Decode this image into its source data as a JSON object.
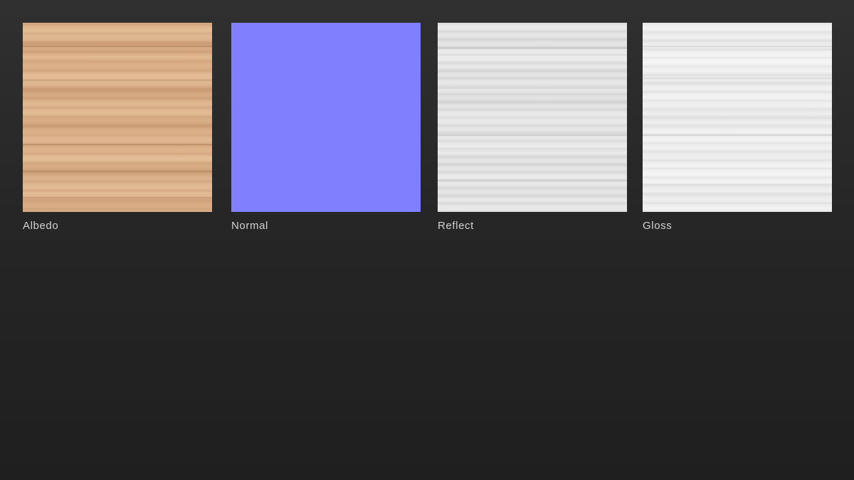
{
  "textures": [
    {
      "label": "Albedo",
      "map_type": "albedo",
      "base_color": "#dbb18a"
    },
    {
      "label": "Normal",
      "map_type": "normal",
      "base_color": "#8080ff"
    },
    {
      "label": "Reflect",
      "map_type": "reflect",
      "base_color": "#e2e2e2"
    },
    {
      "label": "Gloss",
      "map_type": "gloss",
      "base_color": "#ececec"
    }
  ],
  "colors": {
    "label_text": "#d2d2d2",
    "background_top": "#303030",
    "background_bottom": "#1f1f1f"
  }
}
